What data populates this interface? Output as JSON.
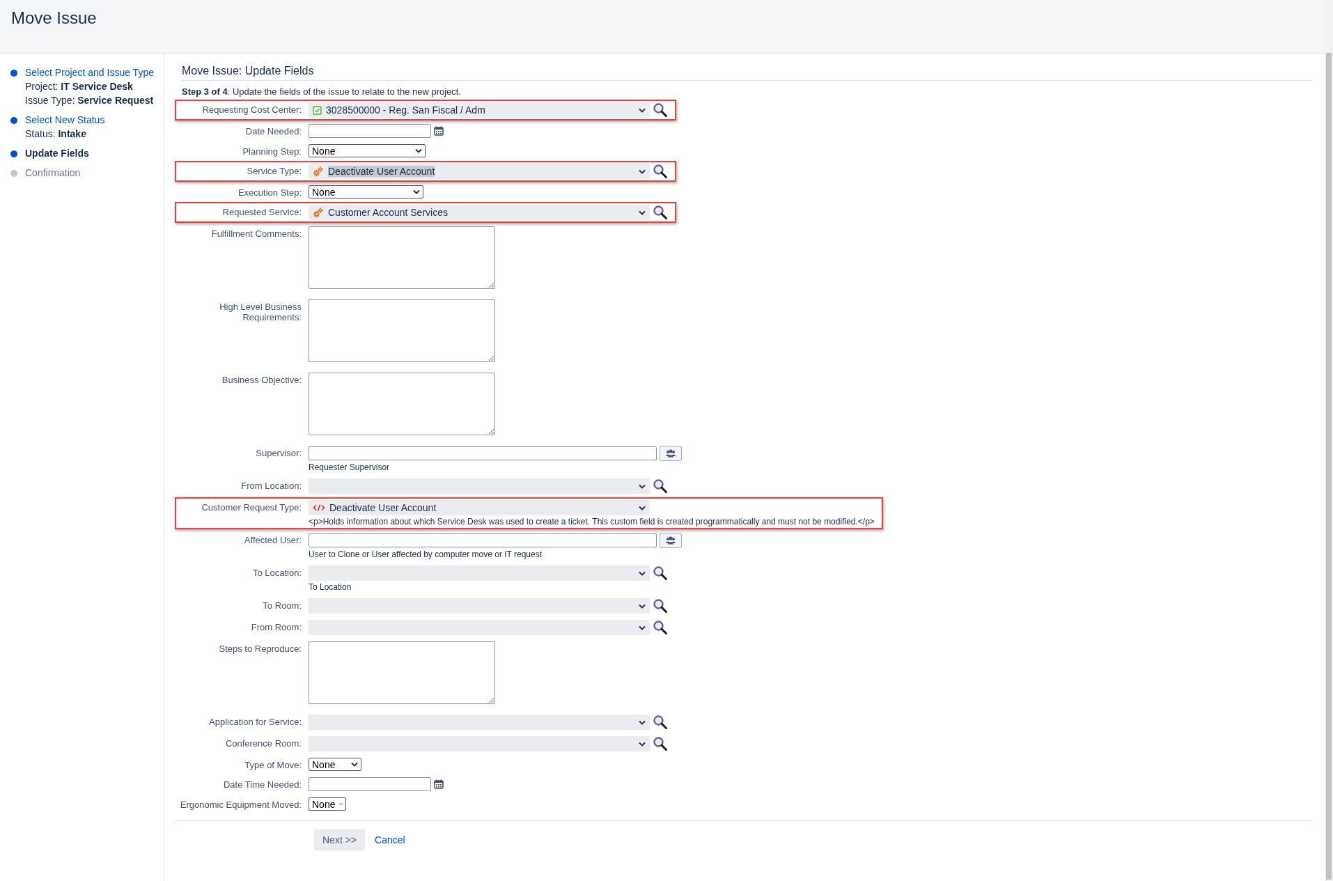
{
  "page_title": "Move Issue",
  "steps": [
    {
      "label": "Select Project and Issue Type",
      "kind": "done",
      "details": [
        "Project: **IT Service Desk**",
        "Issue Type: **Service Request**"
      ]
    },
    {
      "label": "Select New Status",
      "kind": "done",
      "details": [
        "Status: **Intake**"
      ]
    },
    {
      "label": "Update Fields",
      "kind": "current"
    },
    {
      "label": "Confirmation",
      "kind": "pending"
    }
  ],
  "form": {
    "title": "Move Issue: Update Fields",
    "intro": "**Step 3 of 4**: Update the fields of the issue to relate to the new project.",
    "fields": [
      {
        "label": "Requesting Cost Center:",
        "kind": "picker",
        "value": {
          "text": "3028500000 - Reg. San Fiscal / Adm",
          "kind": "check"
        },
        "highlighted": true
      },
      {
        "label": "Date Needed:",
        "kind": "date",
        "highlighted": false
      },
      {
        "label": "Planning Step:",
        "kind": "select",
        "value": "None",
        "highlighted": false
      },
      {
        "label": "Service Type:",
        "kind": "picker",
        "value": {
          "text": "Deactivate User Account",
          "kind": "gears"
        },
        "text_selected": true,
        "highlighted": true
      },
      {
        "label": "Execution Step:",
        "kind": "select",
        "value": "None",
        "highlighted": false
      },
      {
        "label": "Requested Service:",
        "kind": "picker",
        "value": {
          "text": "Customer Account Services",
          "kind": "gears"
        },
        "text_selected": false,
        "highlighted": true
      },
      {
        "label": "Fulfillment Comments:",
        "kind": "textarea",
        "highlighted": false
      },
      {
        "label": "High Level Business Requirements:",
        "kind": "textarea",
        "highlighted": false
      },
      {
        "label": "Business Objective:",
        "kind": "textarea",
        "highlighted": false
      },
      {
        "label": "Supervisor:",
        "kind": "user",
        "description": "Requester Supervisor",
        "highlighted": false
      },
      {
        "label": "From Location:",
        "kind": "picker",
        "highlighted": false
      },
      {
        "label": "Customer Request Type:",
        "kind": "picker_plain",
        "value": {
          "text": "Deactivate User Account",
          "kind": "code"
        },
        "description": "<p>Holds information about which Service Desk was used to create a ticket. This custom field is created programmatically and must not be modified.</p>",
        "highlighted": true
      },
      {
        "label": "Affected User:",
        "kind": "user",
        "description": "User to Clone or User affected by computer move or IT request",
        "highlighted": false
      },
      {
        "label": "To Location:",
        "kind": "picker",
        "description": "To Location",
        "highlighted": false
      },
      {
        "label": "To Room:",
        "kind": "picker",
        "highlighted": false
      },
      {
        "label": "From Room:",
        "kind": "picker",
        "highlighted": false
      },
      {
        "label": "Steps to Reproduce:",
        "kind": "textarea",
        "highlighted": false
      },
      {
        "label": "Application for Service:",
        "kind": "picker",
        "highlighted": false
      },
      {
        "label": "Conference Room:",
        "kind": "picker",
        "highlighted": false
      },
      {
        "label": "Type of Move:",
        "kind": "select",
        "value": "None",
        "highlighted": false
      },
      {
        "label": "Date Time Needed:",
        "kind": "date",
        "highlighted": false
      },
      {
        "label": "Ergonomic Equipment Moved:",
        "kind": "select",
        "value": "None",
        "highlighted": false
      }
    ]
  },
  "buttons": [
    {
      "label": "Next >>",
      "kind": "button"
    },
    {
      "label": "Cancel",
      "kind": "link"
    }
  ]
}
